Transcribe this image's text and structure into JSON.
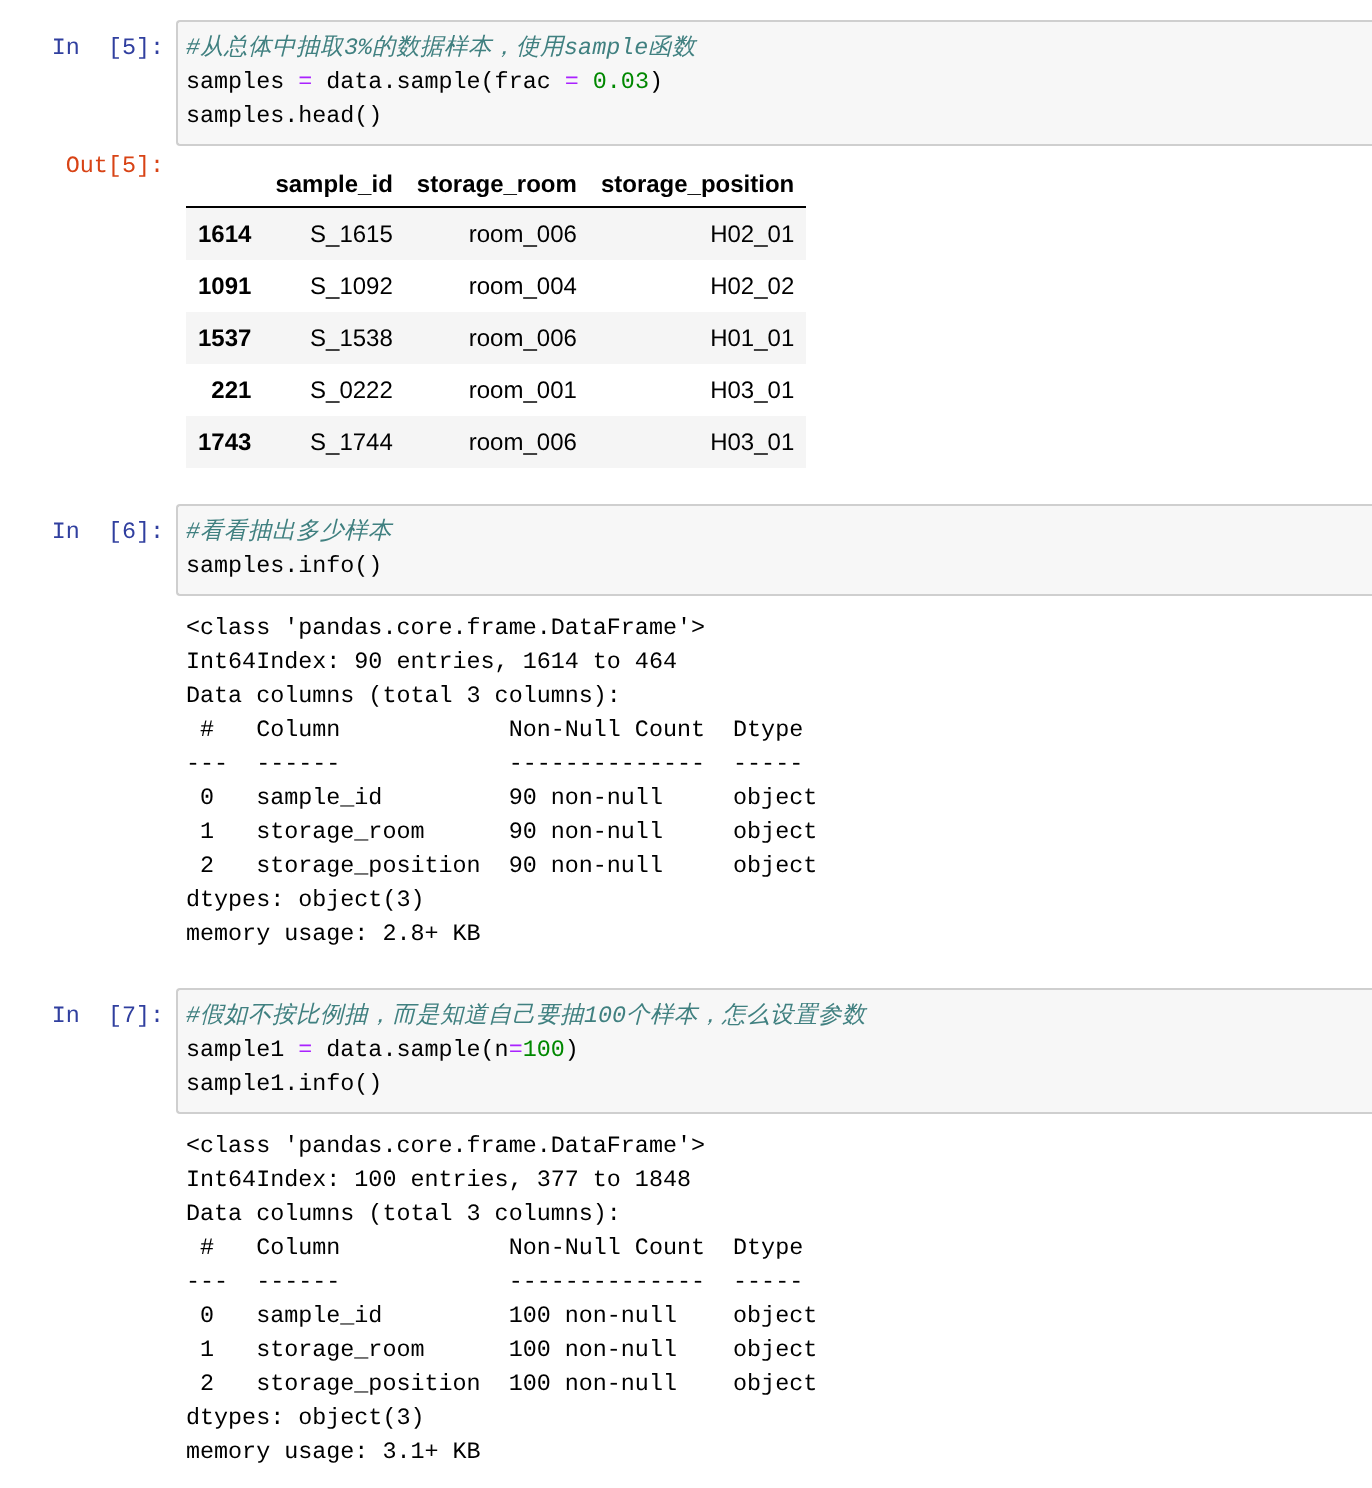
{
  "cells": [
    {
      "prompt": "In  [5]:",
      "code": [
        [
          {
            "kind": "comment",
            "text": "#从总体中抽取3%的数据样本，使用sample函数"
          }
        ],
        [
          {
            "kind": "plain",
            "text": "samples "
          },
          {
            "kind": "op",
            "text": "="
          },
          {
            "kind": "plain",
            "text": " data.sample(frac "
          },
          {
            "kind": "op",
            "text": "="
          },
          {
            "kind": "number",
            "text": " 0.03"
          },
          {
            "kind": "plain",
            "text": ")"
          }
        ],
        [
          {
            "kind": "plain",
            "text": "samples.head()"
          }
        ]
      ],
      "output": {
        "kind": "table",
        "prompt": "Out[5]:",
        "columns": [
          "sample_id",
          "storage_room",
          "storage_position"
        ],
        "rows": [
          {
            "index": "1614",
            "cells": [
              "S_1615",
              "room_006",
              "H02_01"
            ]
          },
          {
            "index": "1091",
            "cells": [
              "S_1092",
              "room_004",
              "H02_02"
            ]
          },
          {
            "index": "1537",
            "cells": [
              "S_1538",
              "room_006",
              "H01_01"
            ]
          },
          {
            "index": "221",
            "cells": [
              "S_0222",
              "room_001",
              "H03_01"
            ]
          },
          {
            "index": "1743",
            "cells": [
              "S_1744",
              "room_006",
              "H03_01"
            ]
          }
        ]
      }
    },
    {
      "prompt": "In  [6]:",
      "code": [
        [
          {
            "kind": "comment",
            "text": "#看看抽出多少样本"
          }
        ],
        [
          {
            "kind": "plain",
            "text": "samples.info()"
          }
        ]
      ],
      "output": {
        "kind": "text",
        "lines": [
          "<class 'pandas.core.frame.DataFrame'>",
          "Int64Index: 90 entries, 1614 to 464",
          "Data columns (total 3 columns):",
          " #   Column            Non-Null Count  Dtype ",
          "---  ------            --------------  ----- ",
          " 0   sample_id         90 non-null     object",
          " 1   storage_room      90 non-null     object",
          " 2   storage_position  90 non-null     object",
          "dtypes: object(3)",
          "memory usage: 2.8+ KB"
        ]
      }
    },
    {
      "prompt": "In  [7]:",
      "code": [
        [
          {
            "kind": "comment",
            "text": "#假如不按比例抽，而是知道自己要抽100个样本，怎么设置参数"
          }
        ],
        [
          {
            "kind": "plain",
            "text": "sample1 "
          },
          {
            "kind": "op",
            "text": "="
          },
          {
            "kind": "plain",
            "text": " data.sample(n"
          },
          {
            "kind": "op",
            "text": "="
          },
          {
            "kind": "number",
            "text": "100"
          },
          {
            "kind": "plain",
            "text": ")"
          }
        ],
        [
          {
            "kind": "plain",
            "text": "sample1.info()"
          }
        ]
      ],
      "output": {
        "kind": "text",
        "lines": [
          "<class 'pandas.core.frame.DataFrame'>",
          "Int64Index: 100 entries, 377 to 1848",
          "Data columns (total 3 columns):",
          " #   Column            Non-Null Count  Dtype ",
          "---  ------            --------------  ----- ",
          " 0   sample_id         100 non-null    object",
          " 1   storage_room      100 non-null    object",
          " 2   storage_position  100 non-null    object",
          "dtypes: object(3)",
          "memory usage: 3.1+ KB"
        ]
      }
    }
  ]
}
